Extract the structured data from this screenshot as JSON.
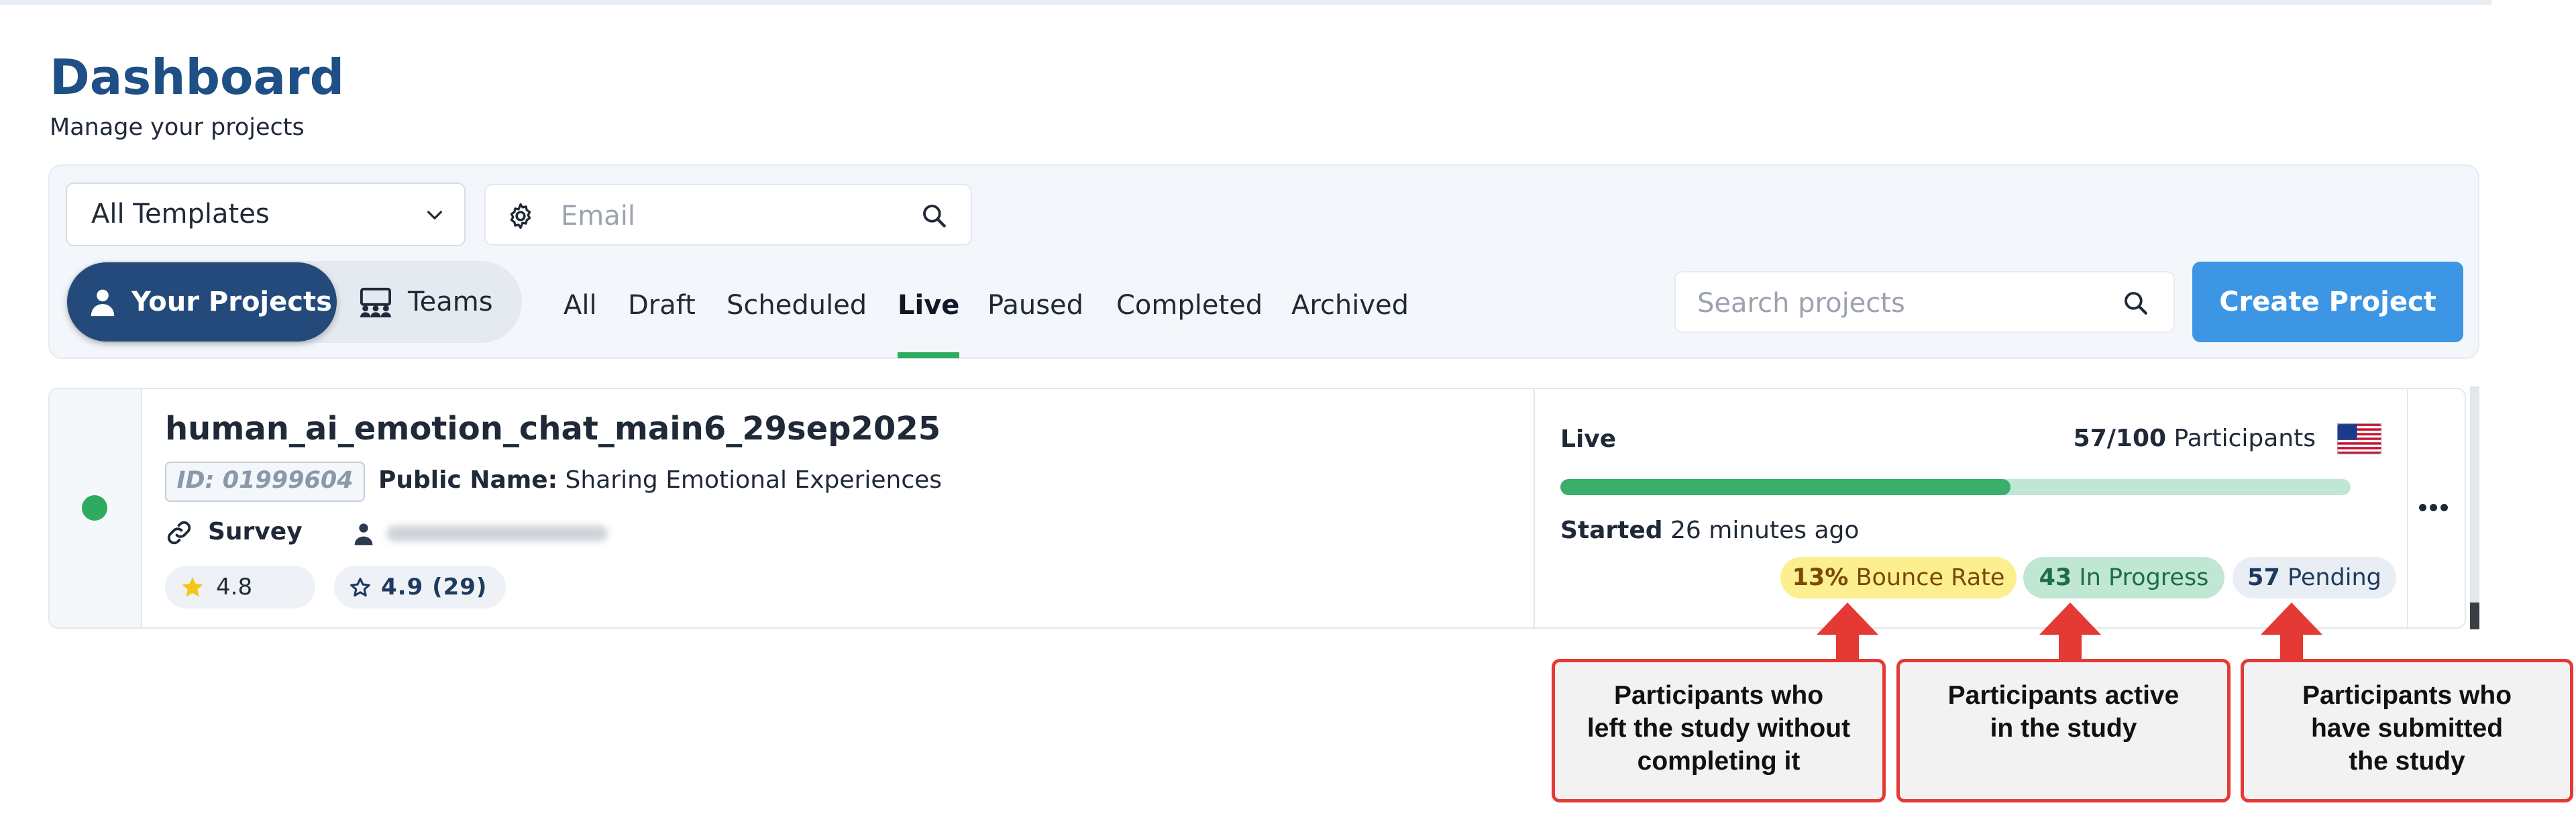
{
  "header": {
    "title": "Dashboard",
    "subtitle": "Manage your projects"
  },
  "filters": {
    "template_select": "All Templates",
    "email_placeholder": "Email",
    "search_placeholder": "Search projects",
    "create_label": "Create Project"
  },
  "toggle": {
    "your_projects": "Your Projects",
    "teams": "Teams"
  },
  "tabs": [
    {
      "label": "All"
    },
    {
      "label": "Draft"
    },
    {
      "label": "Scheduled"
    },
    {
      "label": "Live",
      "active": true
    },
    {
      "label": "Paused"
    },
    {
      "label": "Completed"
    },
    {
      "label": "Archived"
    }
  ],
  "project": {
    "name": "human_ai_emotion_chat_main6_29sep2025",
    "id": "ID: 01999604",
    "public_name_label": "Public Name:",
    "public_name": "Sharing Emotional Experiences",
    "type": "Survey",
    "rating": "4.8",
    "rating_alt": "4.9 (29)",
    "status": "Live",
    "participants_count": "57/100",
    "participants_label": "Participants",
    "progress_fraction": 0.57,
    "started_label": "Started",
    "started_time": "26 minutes ago",
    "bounce_value": "13%",
    "bounce_label": "Bounce Rate",
    "in_progress_value": "43",
    "in_progress_label": "In Progress",
    "pending_value": "57",
    "pending_label": "Pending"
  },
  "callouts": {
    "bounce": [
      "Participants who",
      "left the study without",
      "completing it"
    ],
    "in_progress": [
      "Participants active",
      "in the study"
    ],
    "pending": [
      "Participants who",
      "have submitted",
      "the study"
    ]
  },
  "colors": {
    "brand": "#234a7a",
    "primary_button": "#3d96e3",
    "live_green": "#2eab5f",
    "callout_red": "#e53935"
  },
  "icons": {
    "dropdown": "chevron-down-icon",
    "email_settings": "gear-icon",
    "search": "search-icon",
    "your_projects": "user-icon",
    "teams": "teams-icon",
    "survey": "link-icon",
    "owner": "user-icon",
    "rating": "star-icon",
    "rating_alt": "star-outline-icon",
    "country": "us-flag-icon",
    "more": "more-horizontal-icon"
  }
}
